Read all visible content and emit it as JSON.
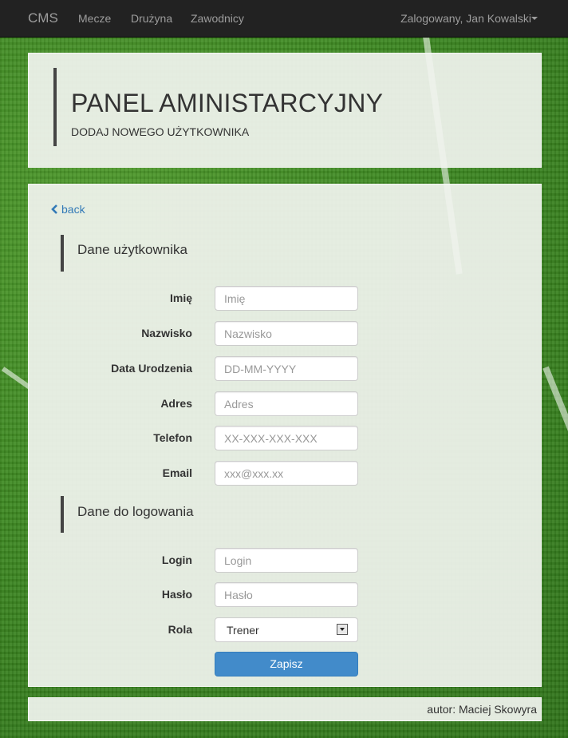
{
  "navbar": {
    "brand": "CMS",
    "links": [
      "Mecze",
      "Drużyna",
      "Zawodnicy"
    ],
    "user": "Zalogowany, Jan Kowalski"
  },
  "header": {
    "title": "PANEL AMINISTARCYJNY",
    "subtitle": "DODAJ NOWEGO UŻYTKOWNIKA"
  },
  "form": {
    "back_label": "back",
    "section_user": "Dane użytkownika",
    "section_login": "Dane do logowania",
    "fields": [
      {
        "label": "Imię",
        "placeholder": "Imię"
      },
      {
        "label": "Nazwisko",
        "placeholder": "Nazwisko"
      },
      {
        "label": "Data Urodzenia",
        "placeholder": "DD-MM-YYYY"
      },
      {
        "label": "Adres",
        "placeholder": "Adres"
      },
      {
        "label": "Telefon",
        "placeholder": "XX-XXX-XXX-XXX"
      },
      {
        "label": "Email",
        "placeholder": "xxx@xxx.xx"
      }
    ],
    "login_fields": [
      {
        "label": "Login",
        "placeholder": "Login"
      },
      {
        "label": "Hasło",
        "placeholder": "Hasło"
      }
    ],
    "role_label": "Rola",
    "role_value": "Trener",
    "submit_label": "Zapisz"
  },
  "footer": {
    "author": "autor: Maciej Skowyra"
  },
  "colors": {
    "navbar": "#222222",
    "accent": "#428bca",
    "link": "#337ab7"
  }
}
